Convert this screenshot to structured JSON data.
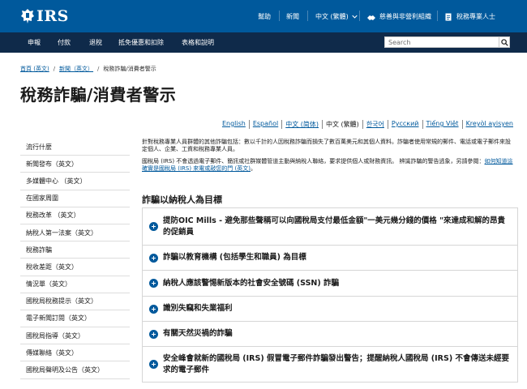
{
  "header": {
    "logo_text": "IRS",
    "utility": {
      "help": "幫助",
      "news": "新聞",
      "language": "中文 (繁體)",
      "charities": "慈善與非營利組織",
      "tax_pros": "稅務專業人士"
    }
  },
  "nav": {
    "items": [
      "申報",
      "付款",
      "退稅",
      "抵免優惠和扣除",
      "表格和說明"
    ],
    "search_placeholder": "Search"
  },
  "breadcrumb": {
    "home": "首頁 (英文)",
    "news": "新聞（英文）",
    "current": "稅務詐騙/消費者警示"
  },
  "page_title": "稅務詐騙/消費者警示",
  "languages": [
    {
      "label": "English",
      "current": false
    },
    {
      "label": "Español",
      "current": false
    },
    {
      "label": "中文 (简体)",
      "current": false
    },
    {
      "label": "中文 (繁體)",
      "current": true
    },
    {
      "label": "한국어",
      "current": false
    },
    {
      "label": "Русский",
      "current": false
    },
    {
      "label": "Tiếng Việt",
      "current": false
    },
    {
      "label": "Kreyòl ayisyen",
      "current": false
    }
  ],
  "sidebar": {
    "items": [
      "流行什麼",
      "新聞發布（英文）",
      "多媒體中心 （英文）",
      "在國家周圍",
      "稅務改革 （英文）",
      "納稅人第一法案（英文）",
      "稅務詐騙",
      "稅收差距（英文）",
      "情況單（英文）",
      "國稅局稅務提示（英文）",
      "電子新聞訂閱（英文）",
      "國稅局指導（英文）",
      "傳媒聯絡（英文）",
      "國稅局聲明及公告（英文）"
    ]
  },
  "intro": {
    "p1": "針對稅務專業人員群體的其他詐騙包括：數以千計的人因稅務詐騙而損失了數百萬美元和其個人資料。詐騙者使用常規的郵件、電話或電子郵件來設定個人、企業、工資和稅務專業人員。",
    "p2_text": "國稅局 (IRS) 不會透過電子郵件、簡訊或社群媒體管道主動與納稅人聯絡，要求提供個人或財務資訊。 辨識詐騙的警告逃象，另請參閱：",
    "p2_link": "如何知道這確實是國稅局 (IRS) 來電或敲您的門 (英文)",
    "p2_end": "。"
  },
  "section": {
    "heading": "詐騙以納稅人為目標",
    "items": [
      "提防OIC Mills - 避免那些聲稱可以向國稅局支付最低金額\"一美元幾分錢的價格 \"來達成和解的昂貴的促銷員",
      "詐騙以教育機構 (包括學生和職員) 為目標",
      "納稅人應該警惕新版本的社會安全號碼 (SSN) 詐騙",
      "識別失竊和失業福利",
      "有關天然災禍的詐騙",
      "安全峰會就新的國稅局 (IRS) 假冒電子郵件詐騙發出警告；提醒納稅人國稅局 (IRS) 不會傳送未經要求的電子郵件"
    ]
  },
  "colors": {
    "topbar": "#00599c",
    "navbar": "#0f2a4a",
    "link": "#00599c",
    "accordion_icon": "#00599c"
  }
}
